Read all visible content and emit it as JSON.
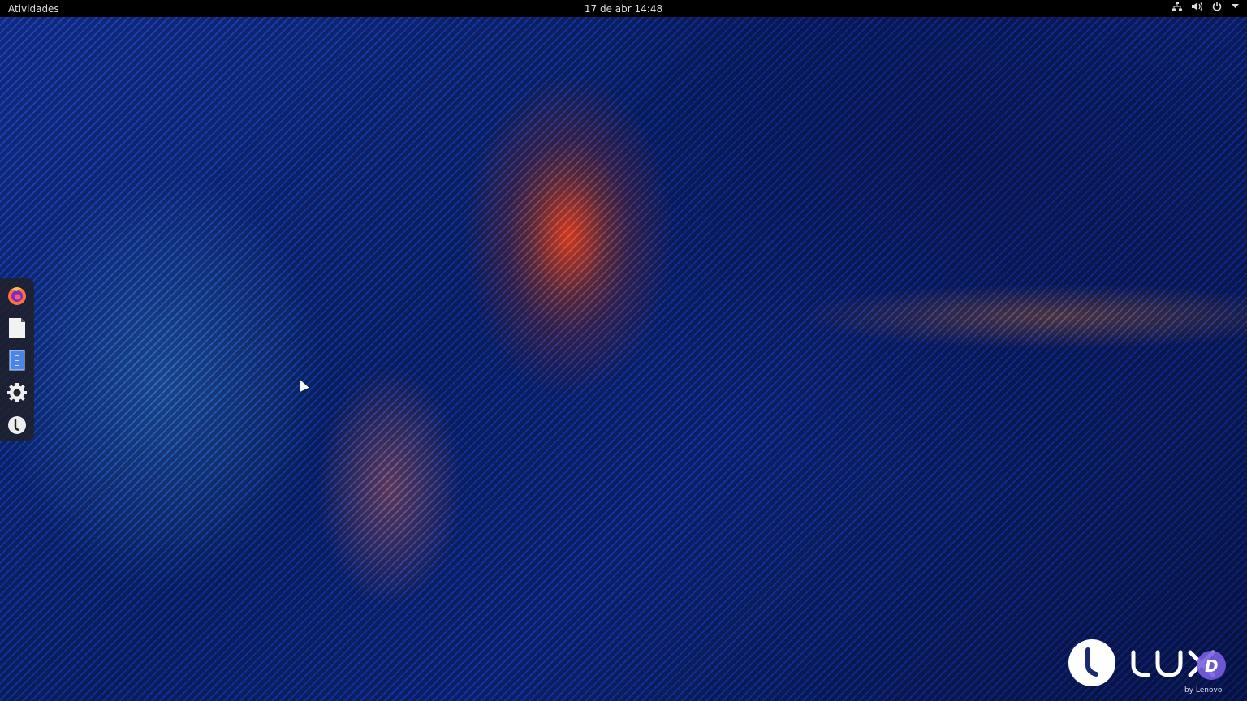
{
  "topbar": {
    "activities_label": "Atividades",
    "datetime": "17 de abr  14:48",
    "tray_icons": [
      "network-icon",
      "volume-icon",
      "power-icon",
      "chevron-down-icon"
    ]
  },
  "dock": {
    "apps": [
      {
        "name": "Firefox",
        "icon": "firefox-icon"
      },
      {
        "name": "Documents",
        "icon": "document-icon"
      },
      {
        "name": "Files",
        "icon": "file-cabinet-icon"
      },
      {
        "name": "Settings",
        "icon": "gear-icon"
      },
      {
        "name": "Lux",
        "icon": "lux-icon"
      }
    ]
  },
  "watermark": {
    "brand": "LUX",
    "tagline": "by Lenovo"
  },
  "colors": {
    "topbar": "#000000",
    "dock": "#1e2028",
    "accent_orange": "#ff5a1e",
    "wallpaper_blue": "#0d2a78"
  }
}
